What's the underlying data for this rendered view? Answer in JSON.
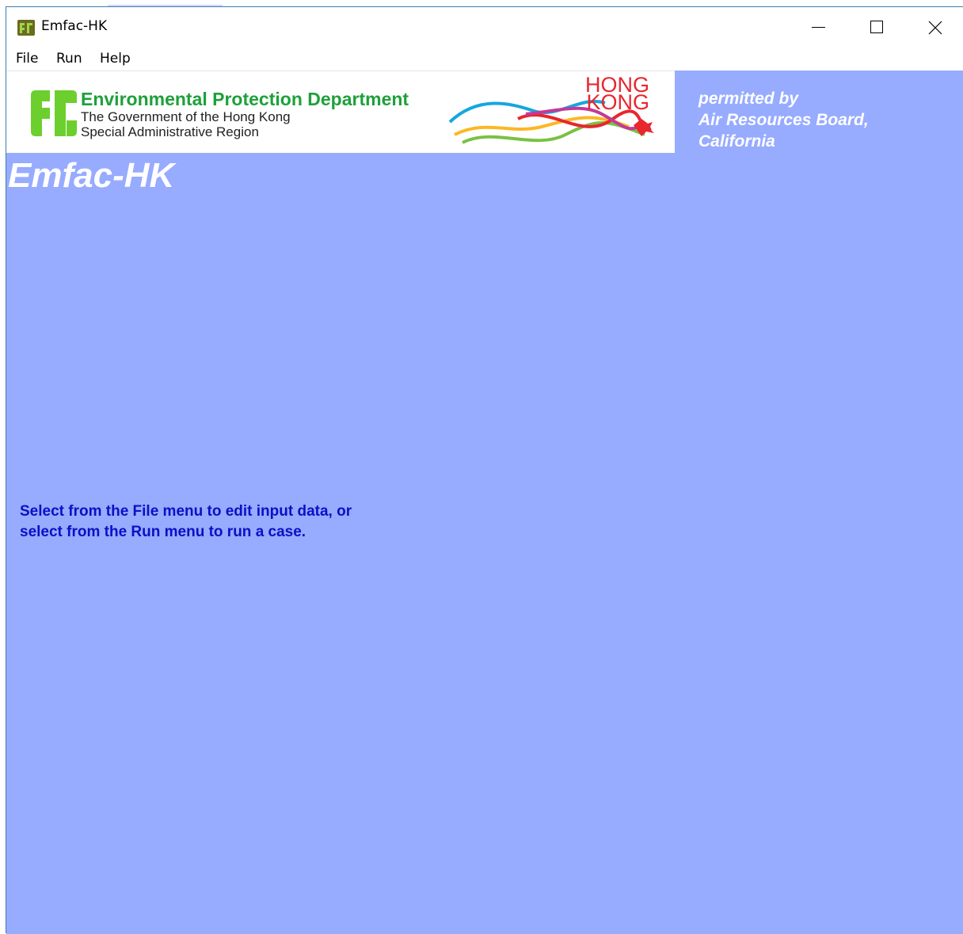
{
  "window": {
    "title": "Emfac-HK",
    "app_icon": "epd-logo-icon",
    "controls": {
      "minimize_icon": "minimize-icon",
      "maximize_icon": "maximize-icon",
      "close_icon": "close-icon"
    }
  },
  "menu": {
    "items": [
      {
        "label": "File"
      },
      {
        "label": "Run"
      },
      {
        "label": "Help"
      }
    ]
  },
  "banner": {
    "department": "Environmental Protection Department",
    "government_line1": "The Government of the Hong Kong",
    "government_line2": "Special Administrative Region",
    "hk_brand": "HONG\nKONG",
    "brand_logo": "hong-kong-dragon-logo"
  },
  "permission": {
    "line1": "permitted by",
    "line2": "Air Resources Board,",
    "line3": "California"
  },
  "main": {
    "app_title": "Emfac-HK",
    "instruction_line1": "Select from the File menu to edit input data, or",
    "instruction_line2": "select from the Run menu to run a case."
  },
  "colors": {
    "client_background": "#97abff",
    "epd_green": "#1ea03a",
    "instruction_blue": "#0b10c6",
    "hk_red": "#e8262d"
  }
}
